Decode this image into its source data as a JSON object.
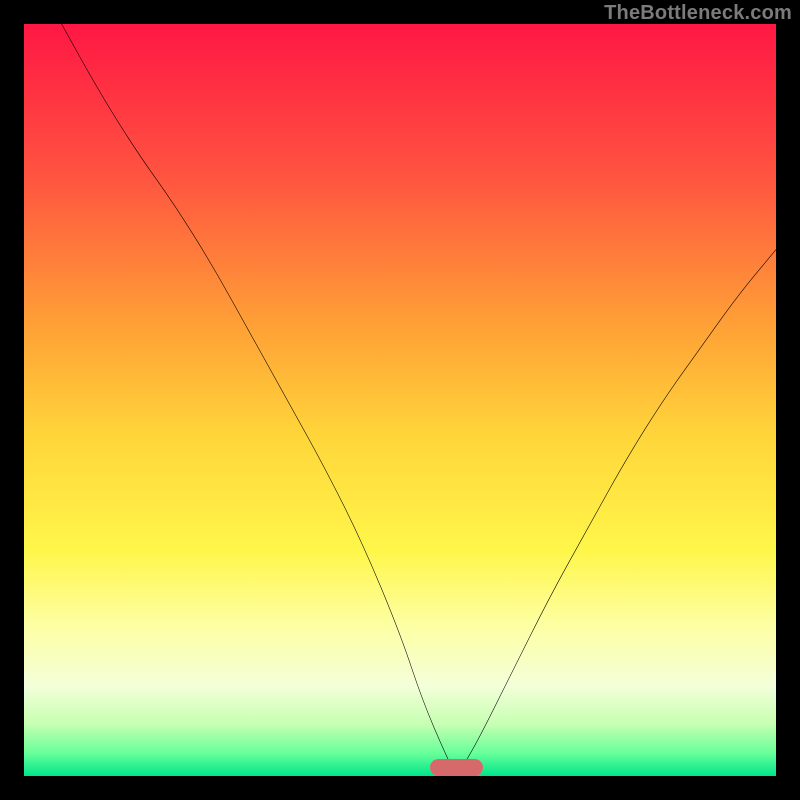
{
  "watermark": "TheBottleneck.com",
  "chart_data": {
    "type": "line",
    "title": "",
    "xlabel": "",
    "ylabel": "",
    "xlim": [
      0,
      100
    ],
    "ylim": [
      0,
      100
    ],
    "grid": false,
    "legend": false,
    "gradient_stops": [
      {
        "pct": 0,
        "color": "#ff1744"
      },
      {
        "pct": 20,
        "color": "#ff5340"
      },
      {
        "pct": 40,
        "color": "#ffa036"
      },
      {
        "pct": 55,
        "color": "#ffd63a"
      },
      {
        "pct": 70,
        "color": "#fff64a"
      },
      {
        "pct": 80,
        "color": "#fdffa3"
      },
      {
        "pct": 88,
        "color": "#f4ffd9"
      },
      {
        "pct": 93,
        "color": "#c8ffb3"
      },
      {
        "pct": 97,
        "color": "#66ff99"
      },
      {
        "pct": 100,
        "color": "#00e58a"
      }
    ],
    "series": [
      {
        "name": "bottleneck-curve",
        "color": "#000000",
        "x": [
          5,
          10,
          15,
          20,
          25,
          30,
          35,
          40,
          45,
          50,
          53,
          56,
          57.5,
          60,
          65,
          70,
          75,
          80,
          85,
          90,
          95,
          100
        ],
        "y": [
          100,
          91,
          83,
          76,
          68,
          59,
          50,
          41,
          31,
          19,
          10,
          3,
          0,
          4,
          14,
          24,
          33,
          42,
          50,
          57,
          64,
          70
        ]
      }
    ],
    "marker": {
      "name": "optimal-zone",
      "color": "#d66a6a",
      "x_start": 54,
      "x_end": 61,
      "y": 0,
      "height": 2.2
    }
  }
}
